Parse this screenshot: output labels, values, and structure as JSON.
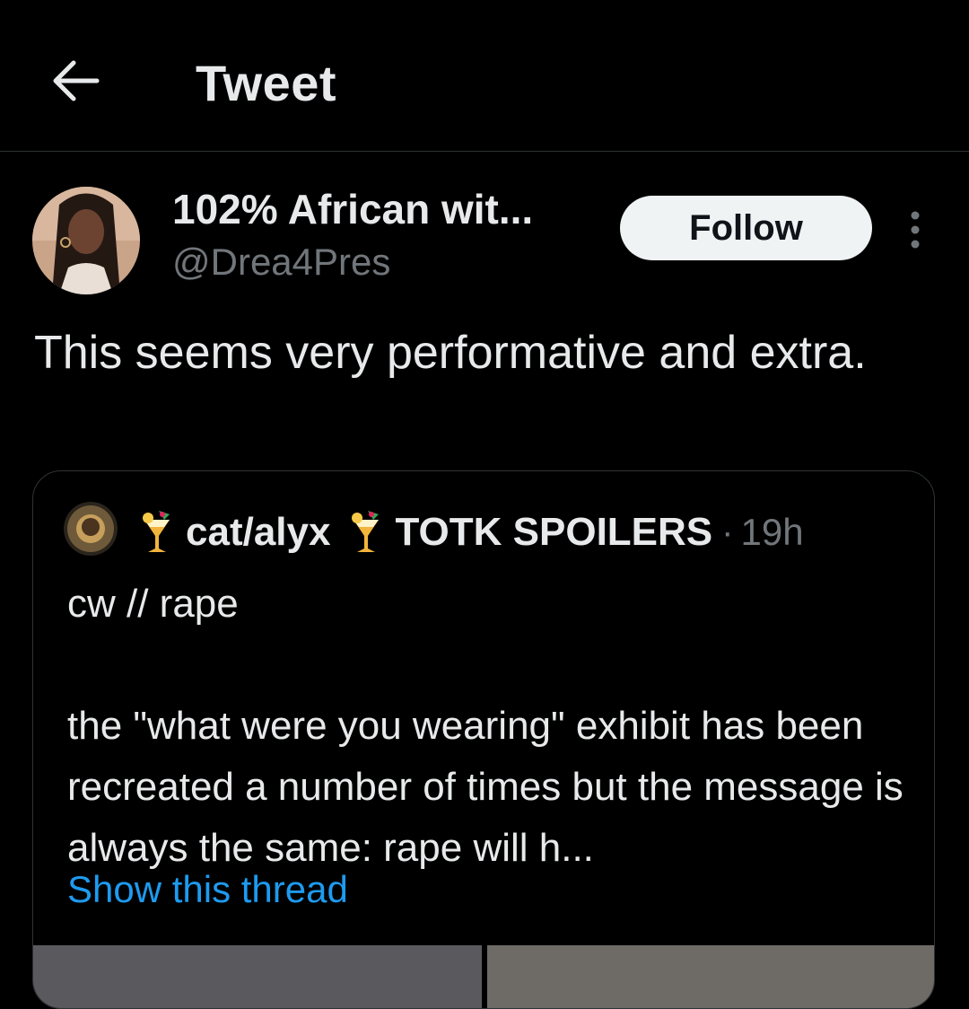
{
  "header": {
    "title": "Tweet",
    "back_icon": "arrow-left-icon"
  },
  "author": {
    "display_name": "102% African wit...",
    "handle": "@Drea4Pres",
    "follow_label": "Follow",
    "more_icon": "more-vertical-icon"
  },
  "tweet": {
    "text": "This seems very performative and extra."
  },
  "quote": {
    "name": "cat/alyx",
    "name_suffix": "TOTK SPOILERS",
    "separator": "·",
    "time": "19h",
    "emoji": "tropical-drink-emoji",
    "body_line1": "cw // rape",
    "body_line2": "the \"what were you wearing\" exhibit has been recreated a number of times but the message is always the same: rape will h...",
    "show_thread": "Show this thread"
  },
  "colors": {
    "background": "#000000",
    "text_primary": "#e7e9ea",
    "text_secondary": "#71767b",
    "link": "#1d9bf0",
    "border": "#2f3336",
    "follow_bg": "#eff3f4"
  }
}
